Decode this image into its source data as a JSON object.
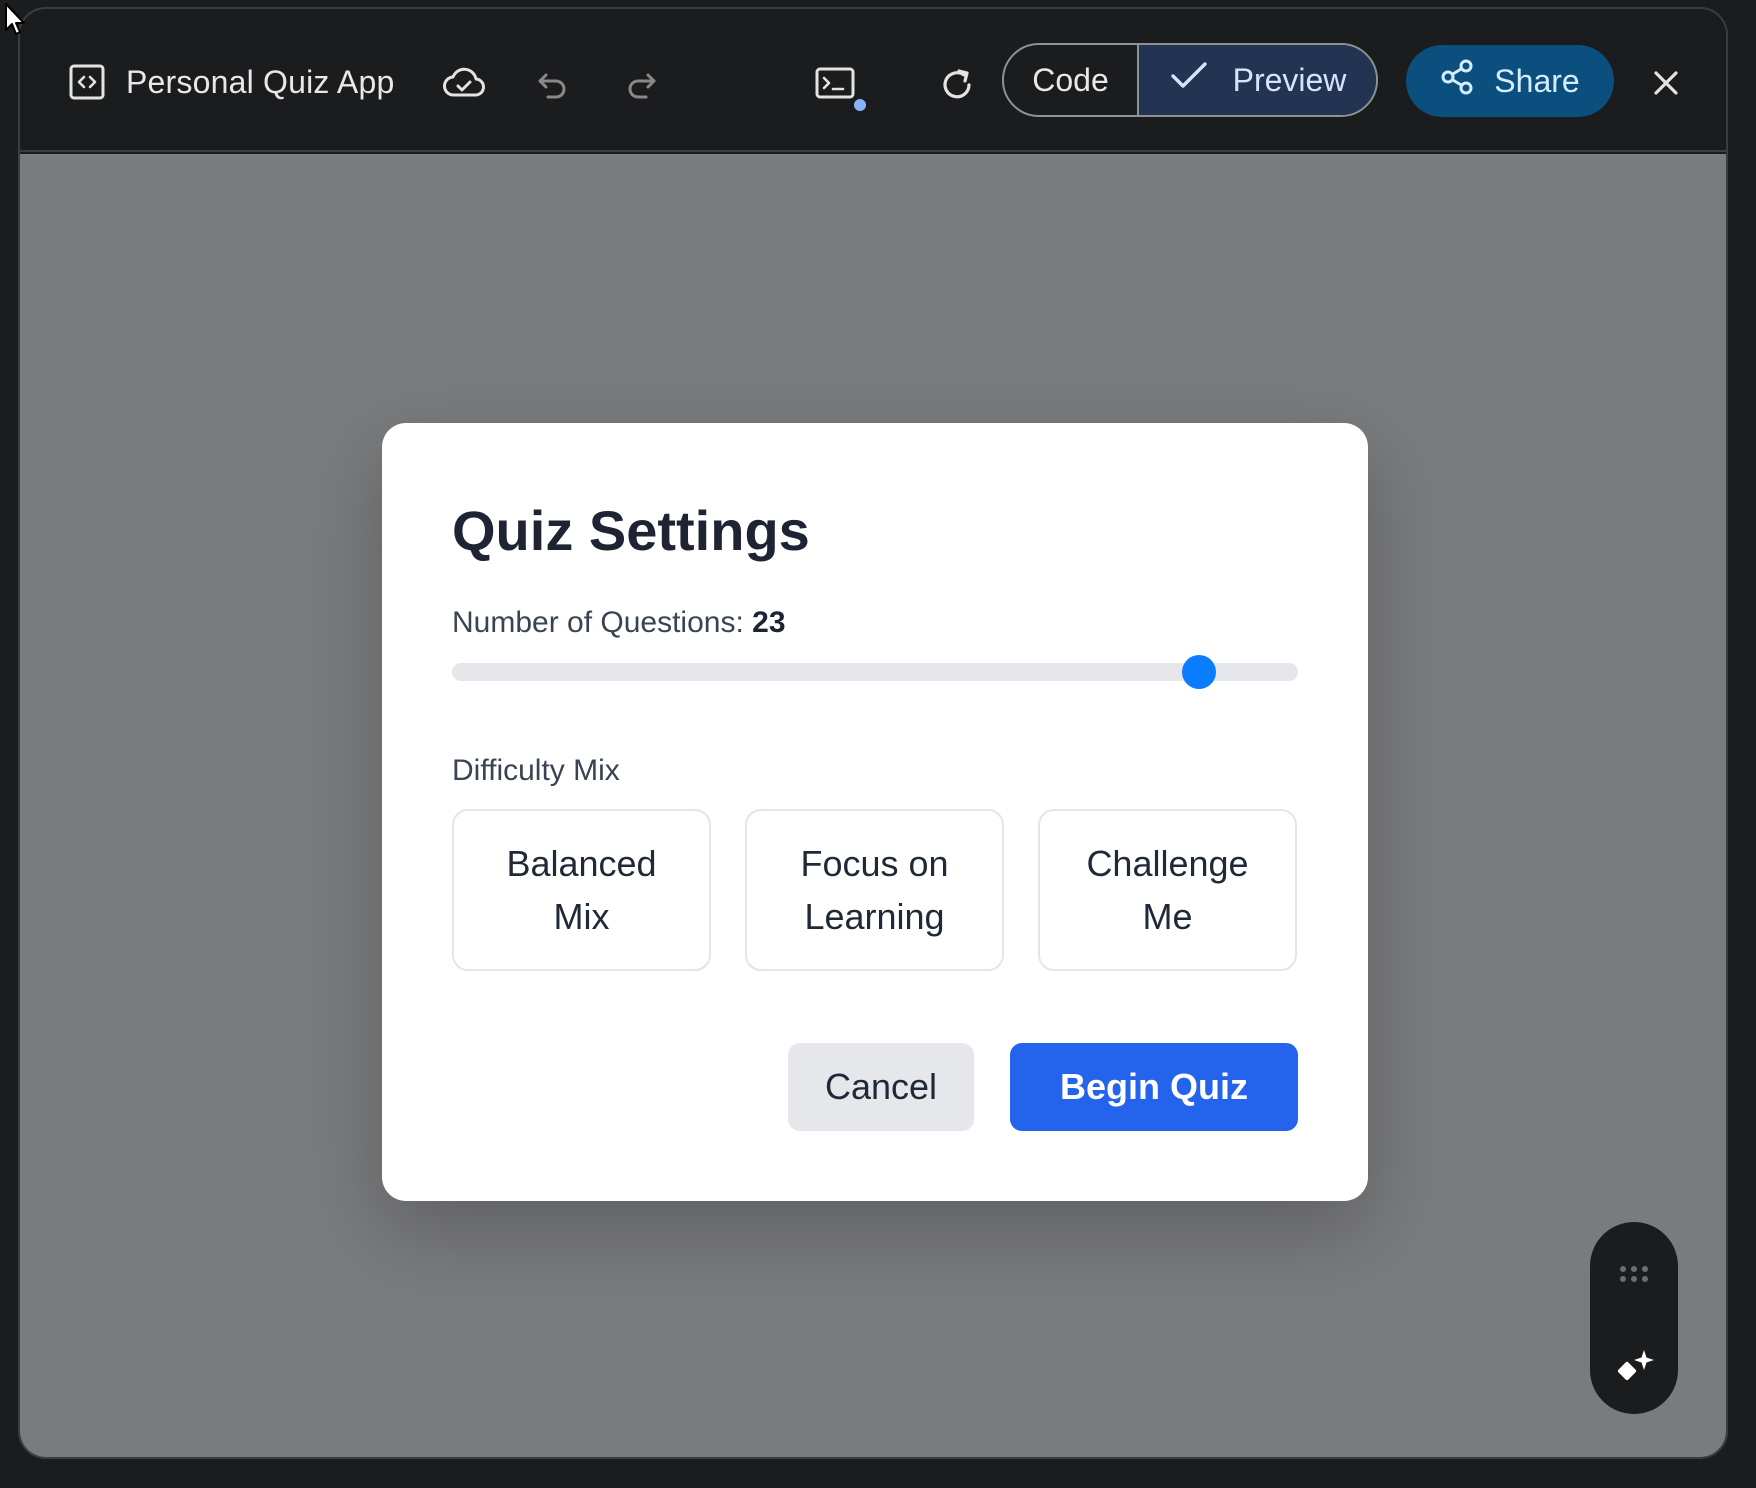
{
  "topbar": {
    "app_title": "Personal Quiz App",
    "icons": {
      "app": "code-box-icon",
      "cloud": "cloud-check-icon",
      "undo": "undo-icon",
      "redo": "redo-icon",
      "terminal": "terminal-icon",
      "refresh": "refresh-icon",
      "check": "check-icon",
      "share": "share-icon",
      "close": "close-icon"
    },
    "code_label": "Code",
    "preview_label": "Preview",
    "share_label": "Share"
  },
  "modal": {
    "title": "Quiz Settings",
    "questions_label": "Number of Questions: ",
    "questions_value": "23",
    "slider_fraction": 0.883,
    "difficulty_label": "Difficulty Mix",
    "options": [
      {
        "label": "Balanced Mix"
      },
      {
        "label": "Focus on Learning"
      },
      {
        "label": "Challenge Me"
      }
    ],
    "cancel_label": "Cancel",
    "begin_label": "Begin Quiz"
  },
  "fab": {
    "icons": {
      "grip": "drag-grip-icon",
      "spark": "sparkle-icon"
    }
  },
  "colors": {
    "accent": "#2463eb",
    "slider_thumb": "#0a7cff",
    "share_bg": "#0a4f7e",
    "preview_bg": "#233352",
    "backdrop": "#7a7b7d"
  }
}
